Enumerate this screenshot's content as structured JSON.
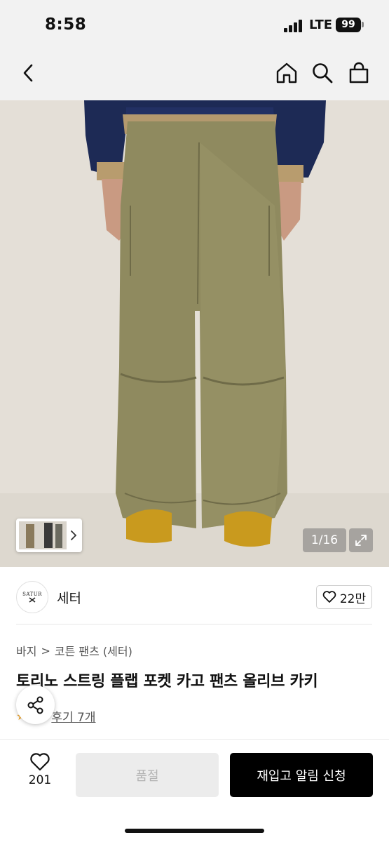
{
  "status_bar": {
    "time": "8:58",
    "network": "LTE",
    "battery": "99"
  },
  "nav": {
    "icons": [
      "back-arrow-icon",
      "home-icon",
      "search-icon",
      "shopping-bag-icon"
    ]
  },
  "gallery": {
    "counter": "1/16",
    "thumbnail_icon": "chevron-right-icon",
    "expand_icon": "expand-icon"
  },
  "brand": {
    "logo_text": "SATUR",
    "name": "세터",
    "like_count": "22만"
  },
  "breadcrumb": {
    "category": "바지",
    "separator": ">",
    "subcategory": "코튼 팬츠 (세터)"
  },
  "product": {
    "title": "토리노 스트링 플랩 포켓 카고 팬츠 올리브 카키",
    "review_link": "후기 7개"
  },
  "bottom_bar": {
    "wish_count": "201",
    "soldout_label": "품절",
    "restock_label": "재입고 알림 신청"
  },
  "colors": {
    "accent": "#000000",
    "disabled_bg": "#ececec",
    "star": "#f5a623"
  }
}
